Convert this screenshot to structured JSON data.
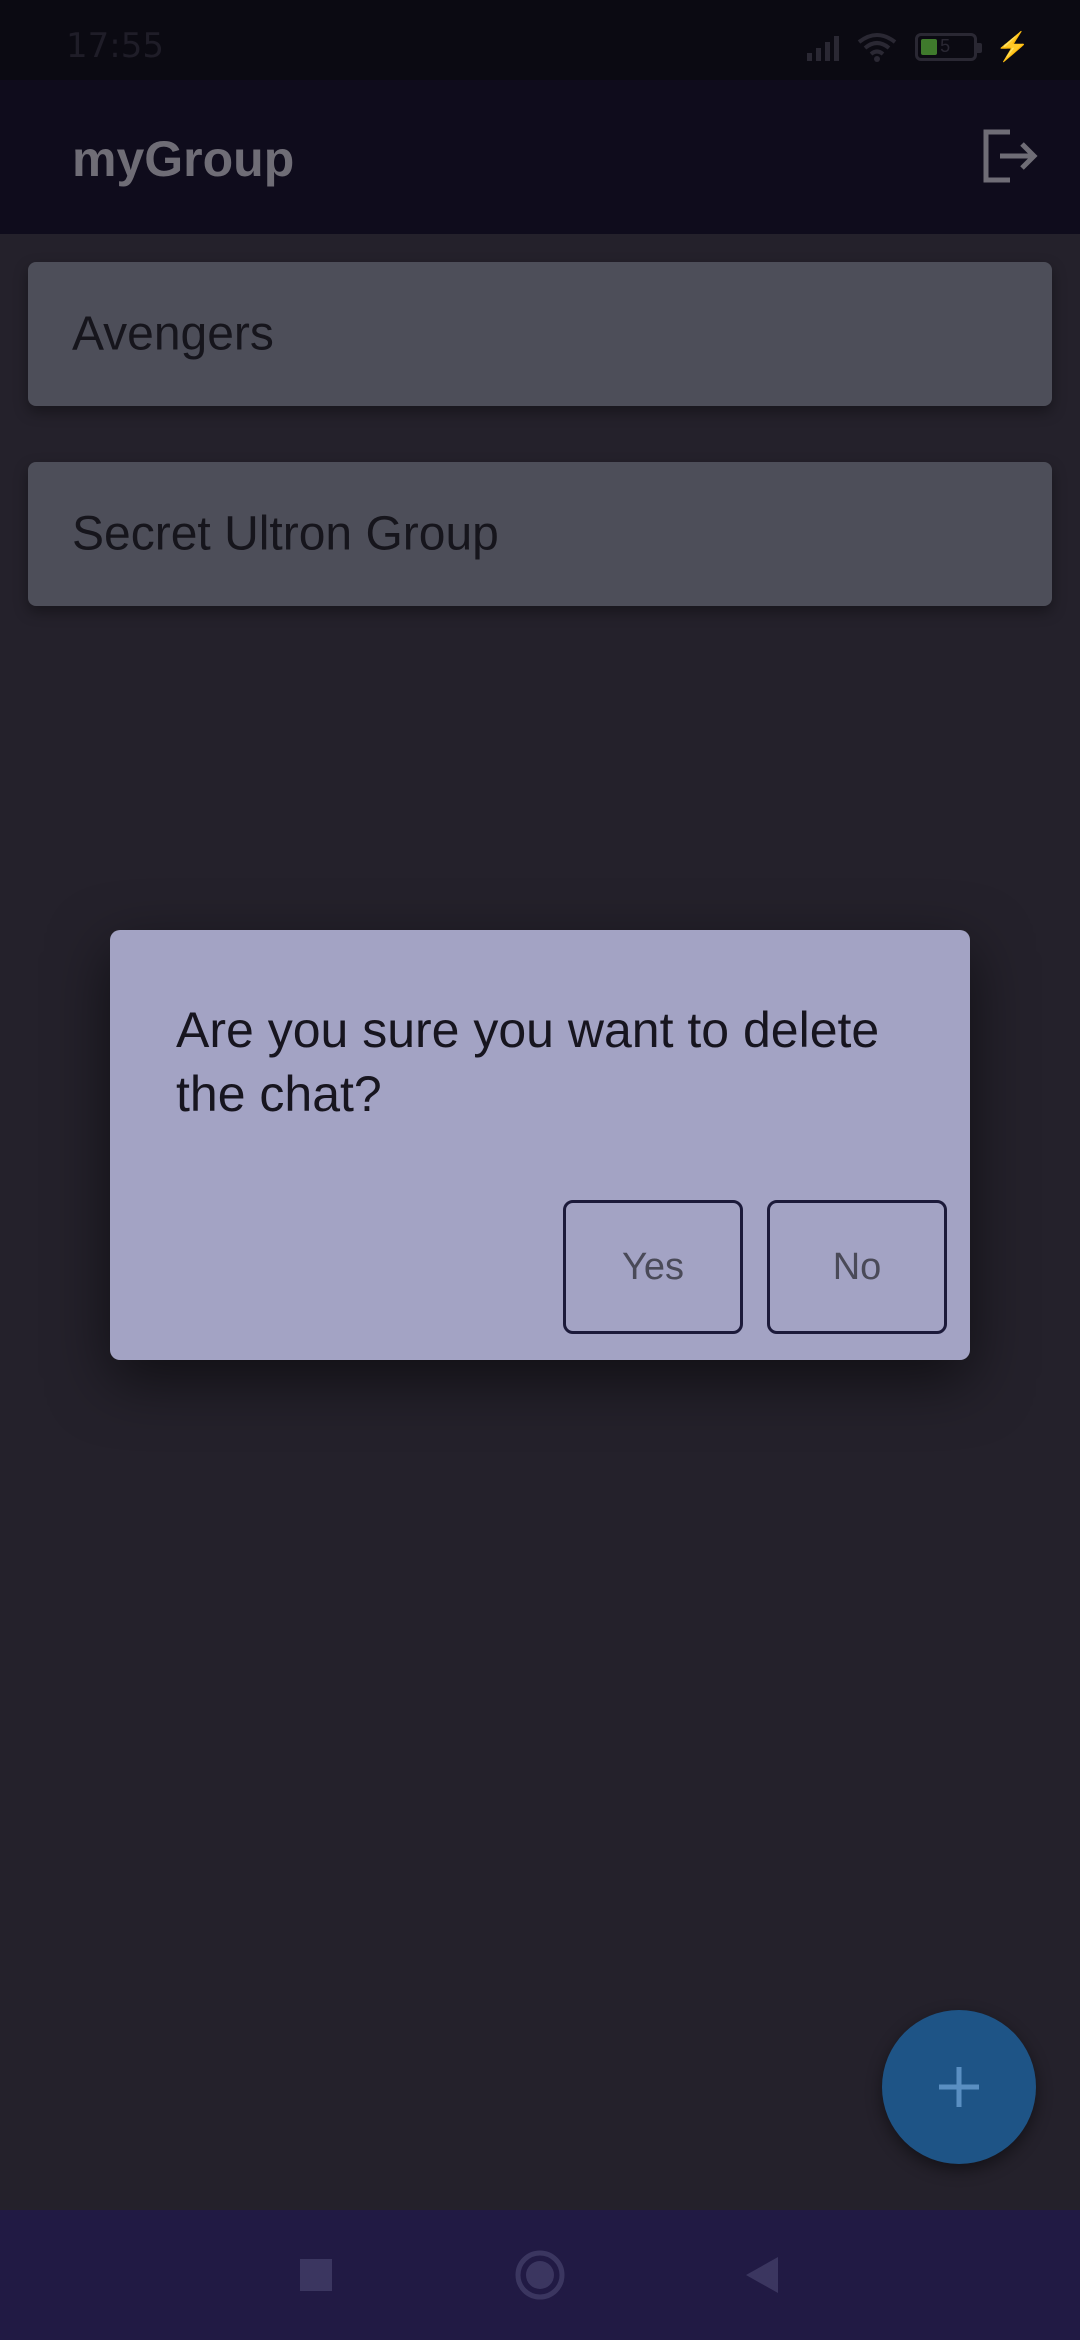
{
  "status_bar": {
    "time": "17:55",
    "battery": "5",
    "icons": [
      "signal-icon",
      "wifi-icon",
      "battery-icon",
      "charging-bolt-icon"
    ]
  },
  "app_bar": {
    "title": "myGroup",
    "action_icon": "logout-icon"
  },
  "chats": [
    {
      "name": "Avengers"
    },
    {
      "name": "Secret Ultron Group"
    }
  ],
  "dialog": {
    "message": "Are you sure you want to delete the chat?",
    "yes_label": "Yes",
    "no_label": "No"
  },
  "fab": {
    "icon": "plus-icon"
  },
  "nav_bar": {
    "icons": [
      "recents-square-icon",
      "home-circle-icon",
      "back-triangle-icon"
    ]
  },
  "colors": {
    "app_bar": "#0f0c1c",
    "background": "#24212b",
    "chat_item": "#4d4e59",
    "dialog": "#a3a3c4",
    "fab": "#1e5486",
    "nav_bar": "#211a44"
  }
}
